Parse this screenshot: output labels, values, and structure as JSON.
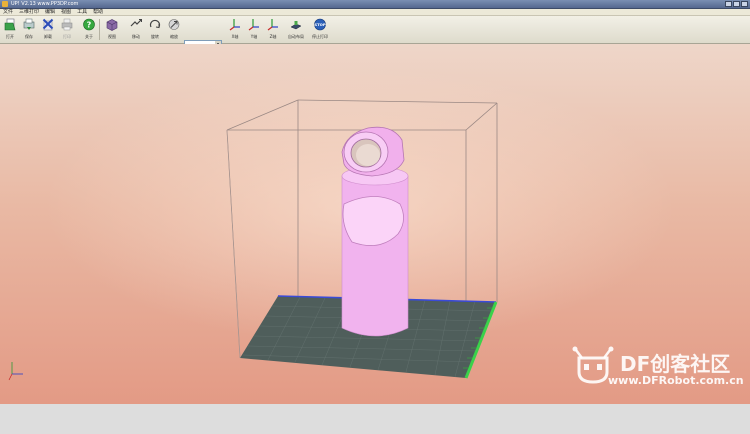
{
  "window": {
    "title": "UP! V2.13 www.PP3DP.com"
  },
  "menu": [
    "文件",
    "三维打印",
    "编辑",
    "视图",
    "工具",
    "帮助"
  ],
  "toolbar": {
    "items": [
      {
        "label": "打开",
        "icon": "open-icon"
      },
      {
        "label": "保存",
        "icon": "save-icon"
      },
      {
        "label": "卸载",
        "icon": "unload-icon"
      },
      {
        "label": "打印",
        "icon": "print-icon",
        "disabled": true
      },
      {
        "label": "关于",
        "icon": "help-icon"
      },
      {
        "label": "视图",
        "icon": "view-icon"
      },
      {
        "label": "移动",
        "icon": "move-icon"
      },
      {
        "label": "旋转",
        "icon": "rotate-icon"
      },
      {
        "label": "缩放",
        "icon": "scale-icon"
      },
      {
        "label": "X轴",
        "icon": "x-axis-icon"
      },
      {
        "label": "Y轴",
        "icon": "y-axis-icon"
      },
      {
        "label": "Z轴",
        "icon": "z-axis-icon"
      },
      {
        "label": "自动布局",
        "icon": "auto-layout-icon"
      },
      {
        "label": "停止打印",
        "icon": "stop-print-icon"
      }
    ],
    "zoom_value": ""
  },
  "watermark": {
    "brand": "DF创客社区",
    "site": "www.DFRobot.com.cn"
  },
  "colors": {
    "model": "#f4b8f0",
    "platform": "#4d5e5a",
    "grid_x": "#3a4ad8",
    "grid_y": "#3ad24a"
  }
}
